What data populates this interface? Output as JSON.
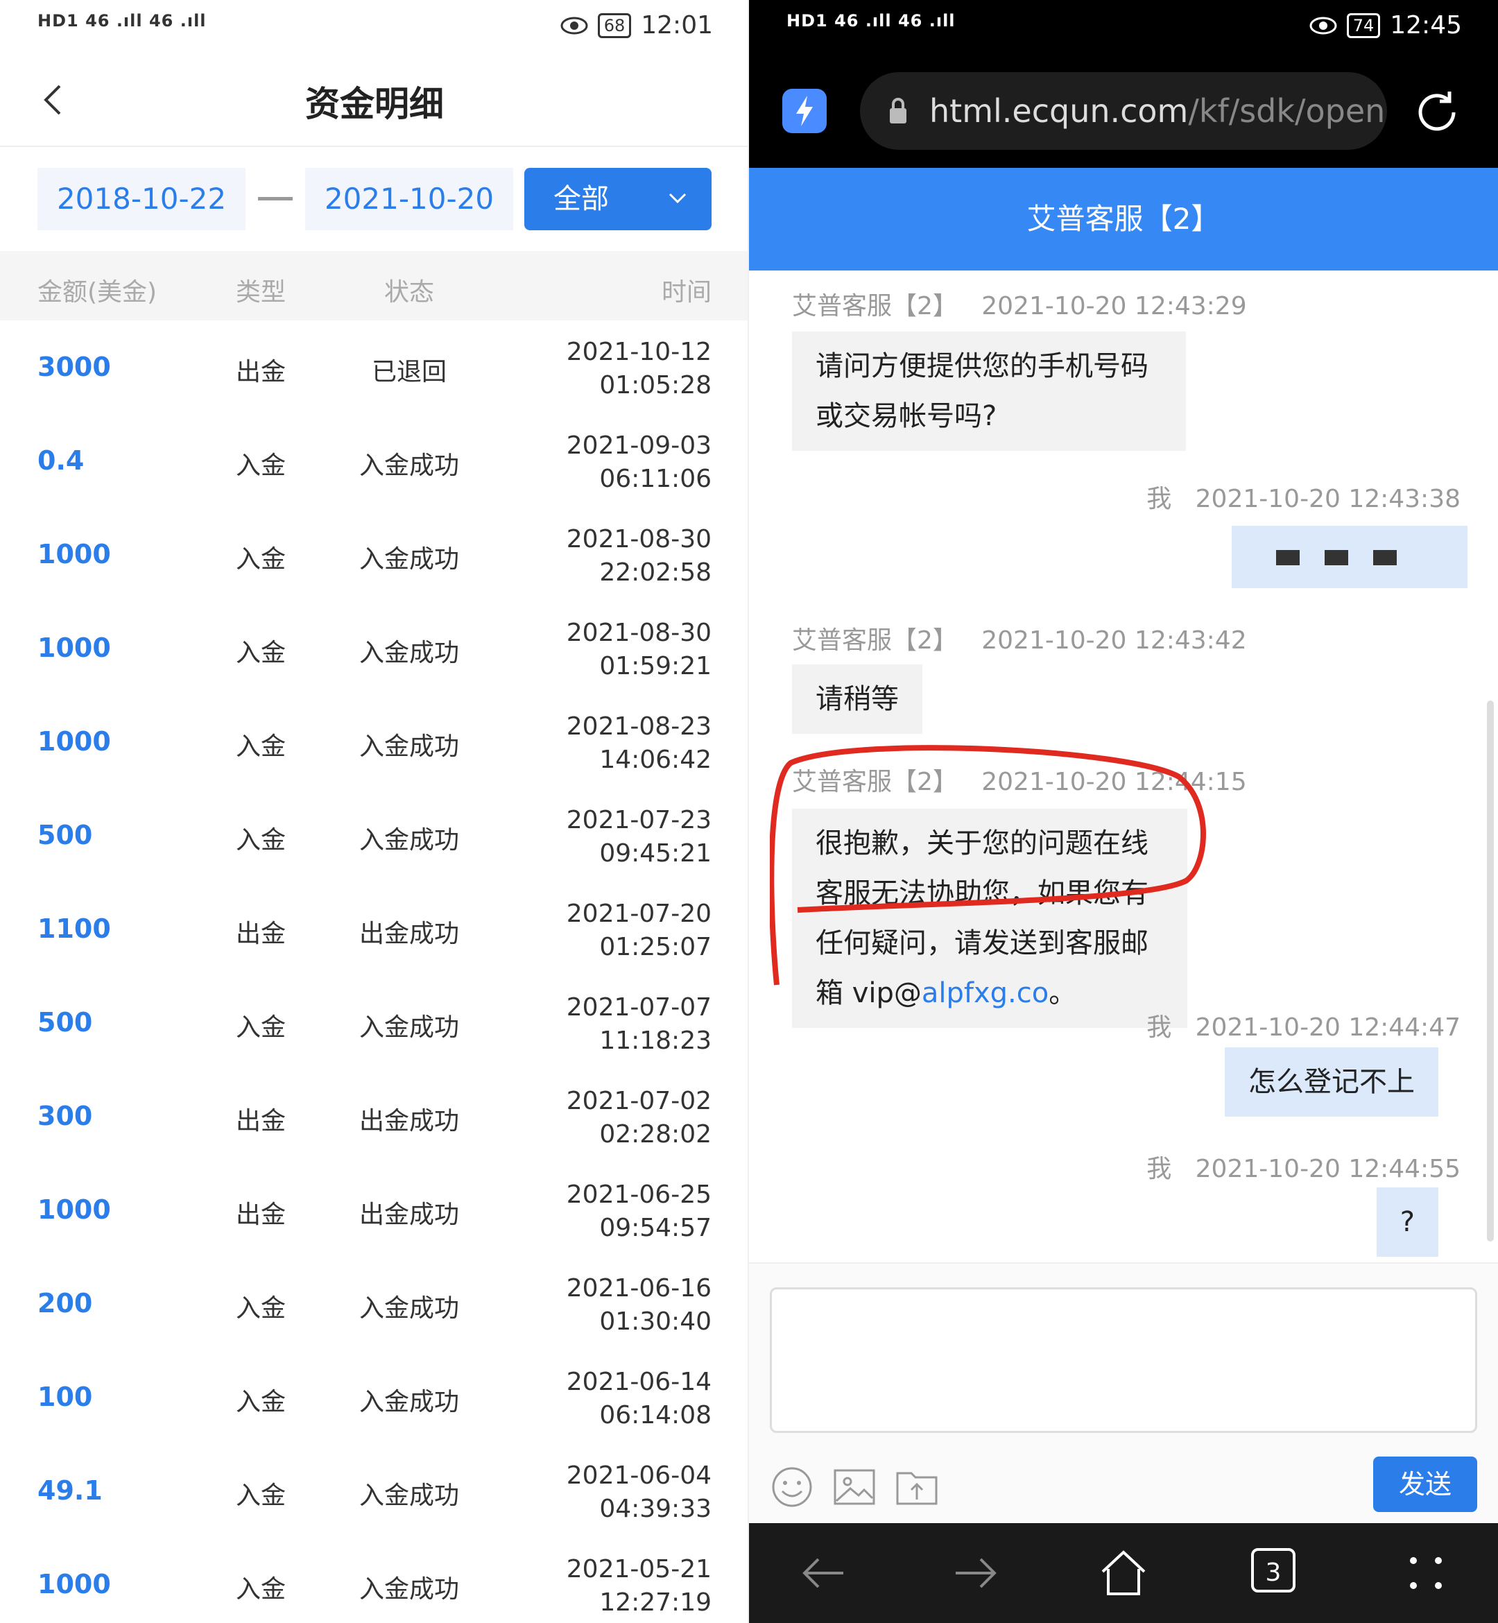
{
  "left_status": {
    "signal": "HD1 46 .ıll 46 .ıll",
    "battery": "68",
    "time": "12:01"
  },
  "left_header": {
    "title": "资金明细"
  },
  "filter": {
    "start_date": "2018-10-22",
    "end_date": "2021-10-20",
    "select_label": "全部"
  },
  "table": {
    "headers": [
      "金额(美金)",
      "类型",
      "状态",
      "时间"
    ],
    "rows": [
      {
        "amount": "3000",
        "type": "出金",
        "status": "已退回",
        "date": "2021-10-12",
        "time": "01:05:28"
      },
      {
        "amount": "0.4",
        "type": "入金",
        "status": "入金成功",
        "date": "2021-09-03",
        "time": "06:11:06"
      },
      {
        "amount": "1000",
        "type": "入金",
        "status": "入金成功",
        "date": "2021-08-30",
        "time": "22:02:58"
      },
      {
        "amount": "1000",
        "type": "入金",
        "status": "入金成功",
        "date": "2021-08-30",
        "time": "01:59:21"
      },
      {
        "amount": "1000",
        "type": "入金",
        "status": "入金成功",
        "date": "2021-08-23",
        "time": "14:06:42"
      },
      {
        "amount": "500",
        "type": "入金",
        "status": "入金成功",
        "date": "2021-07-23",
        "time": "09:45:21"
      },
      {
        "amount": "1100",
        "type": "出金",
        "status": "出金成功",
        "date": "2021-07-20",
        "time": "01:25:07"
      },
      {
        "amount": "500",
        "type": "入金",
        "status": "入金成功",
        "date": "2021-07-07",
        "time": "11:18:23"
      },
      {
        "amount": "300",
        "type": "出金",
        "status": "出金成功",
        "date": "2021-07-02",
        "time": "02:28:02"
      },
      {
        "amount": "1000",
        "type": "出金",
        "status": "出金成功",
        "date": "2021-06-25",
        "time": "09:54:57"
      },
      {
        "amount": "200",
        "type": "入金",
        "status": "入金成功",
        "date": "2021-06-16",
        "time": "01:30:40"
      },
      {
        "amount": "100",
        "type": "入金",
        "status": "入金成功",
        "date": "2021-06-14",
        "time": "06:14:08"
      },
      {
        "amount": "49.1",
        "type": "入金",
        "status": "入金成功",
        "date": "2021-06-04",
        "time": "04:39:33"
      },
      {
        "amount": "1000",
        "type": "入金",
        "status": "入金成功",
        "date": "2021-05-21",
        "time": "12:27:19"
      }
    ]
  },
  "right_status": {
    "signal": "HD1 46 .ıll 46 .ıll",
    "battery": "74",
    "time": "12:45"
  },
  "browser": {
    "url_main": "html.ecqun.com",
    "url_path": "/kf/sdk/open",
    "tab_count": "3"
  },
  "chat": {
    "title": "艾普客服【2】",
    "messages": [
      {
        "sender": "艾普客服【2】",
        "time": "2021-10-20 12:43:29",
        "text": "请问方便提供您的手机号码或交易帐号吗?"
      },
      {
        "sender": "我",
        "time": "2021-10-20 12:43:38",
        "text": ""
      },
      {
        "sender": "艾普客服【2】",
        "time": "2021-10-20 12:43:42",
        "text": "请稍等"
      },
      {
        "sender": "艾普客服【2】",
        "time": "2021-10-20 12:44:15",
        "text_a": "很抱歉，关于您的问题在线客服无法协助您，如果您有任何疑问，请发送到客服邮箱 vip@",
        "text_link": "alpfxg.co",
        "text_b": "。"
      },
      {
        "sender": "我",
        "time": "2021-10-20 12:44:47",
        "text": "怎么登记不上"
      },
      {
        "sender": "我",
        "time": "2021-10-20 12:44:55",
        "text": "?"
      }
    ],
    "send_label": "发送"
  },
  "colors": {
    "accent": "#2b7de9",
    "header_blue": "#3689f4",
    "highlight_red": "#e02a1f"
  }
}
